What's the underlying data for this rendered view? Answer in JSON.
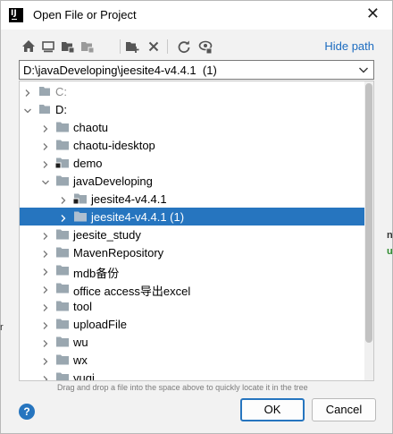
{
  "window": {
    "title": "Open File or Project",
    "app_icon_text": "IJ"
  },
  "toolbar": {
    "buttons": [
      "home-icon",
      "desktop-icon",
      "project-folder-icon",
      "module-folder-icon",
      "new-folder-icon",
      "delete-icon",
      "refresh-icon",
      "show-hidden-icon"
    ],
    "hide_path_label": "Hide path"
  },
  "path": {
    "value": "D:\\javaDeveloping\\jeesite4-v4.4.1  (1)"
  },
  "tree": {
    "items": [
      {
        "label": "C:",
        "depth": 0,
        "expanded": false,
        "drive": true,
        "dim": true
      },
      {
        "label": "D:",
        "depth": 0,
        "expanded": true,
        "drive": true
      },
      {
        "label": "chaotu",
        "depth": 1,
        "expanded": false
      },
      {
        "label": "chaotu-idesktop",
        "depth": 1,
        "expanded": false
      },
      {
        "label": "demo",
        "depth": 1,
        "expanded": false,
        "module": true
      },
      {
        "label": "javaDeveloping",
        "depth": 1,
        "expanded": true
      },
      {
        "label": "jeesite4-v4.4.1",
        "depth": 2,
        "expanded": false,
        "module": true
      },
      {
        "label": "jeesite4-v4.4.1  (1)",
        "depth": 2,
        "expanded": false,
        "selected": true
      },
      {
        "label": "jeesite_study",
        "depth": 1,
        "expanded": false
      },
      {
        "label": "MavenRepository",
        "depth": 1,
        "expanded": false
      },
      {
        "label": "mdb备份",
        "depth": 1,
        "expanded": false
      },
      {
        "label": "office access导出excel",
        "depth": 1,
        "expanded": false
      },
      {
        "label": "tool",
        "depth": 1,
        "expanded": false
      },
      {
        "label": "uploadFile",
        "depth": 1,
        "expanded": false
      },
      {
        "label": "wu",
        "depth": 1,
        "expanded": false
      },
      {
        "label": "wx",
        "depth": 1,
        "expanded": false
      },
      {
        "label": "yuqi",
        "depth": 1,
        "expanded": false
      }
    ]
  },
  "hint": "Drag and drop a file into the space above to quickly locate it in the tree",
  "buttons": {
    "help": "?",
    "ok": "OK",
    "cancel": "Cancel"
  },
  "background_fragments": [
    "nt",
    "up",
    "r"
  ],
  "colors": {
    "accent": "#2675bf",
    "link": "#1c6cc0",
    "folder": "#9aa7b0"
  }
}
